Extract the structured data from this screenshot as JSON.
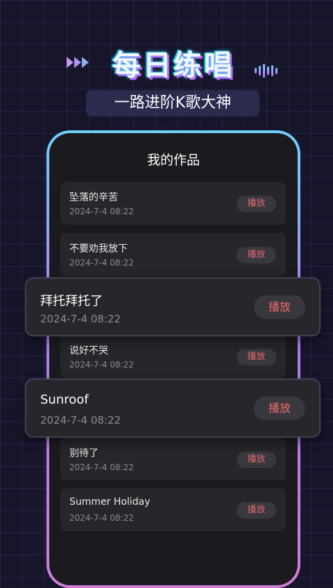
{
  "header": {
    "title": "每日练唱",
    "subtitle": "一路进阶K歌大神"
  },
  "screen": {
    "title": "我的作品",
    "play_label": "播放",
    "items": [
      {
        "name": "坠落的辛苦",
        "date": "2024-7-4   08:22"
      },
      {
        "name": "不要劝我放下",
        "date": "2024-7-4   08:22"
      },
      {
        "name": "说好不哭",
        "date": "2024-7-4   08:22"
      },
      {
        "name": "别待了",
        "date": "2024-7-4   08:22"
      },
      {
        "name": "Summer Holiday",
        "date": "2024-7-4   08:22"
      }
    ],
    "highlighted": [
      {
        "name": "拜托拜托了",
        "date": "2024-7-4   08:22"
      },
      {
        "name": "Sunroof",
        "date": "2024-7-4   08:22"
      }
    ]
  },
  "icons": {
    "arrows": "triple-chevron-right-icon",
    "wave": "sound-wave-icon"
  },
  "colors": {
    "background": "#16152a",
    "accent_cyan": "#6fd0ff",
    "accent_purple": "#b07cf2",
    "play_text": "#e06a6a"
  }
}
